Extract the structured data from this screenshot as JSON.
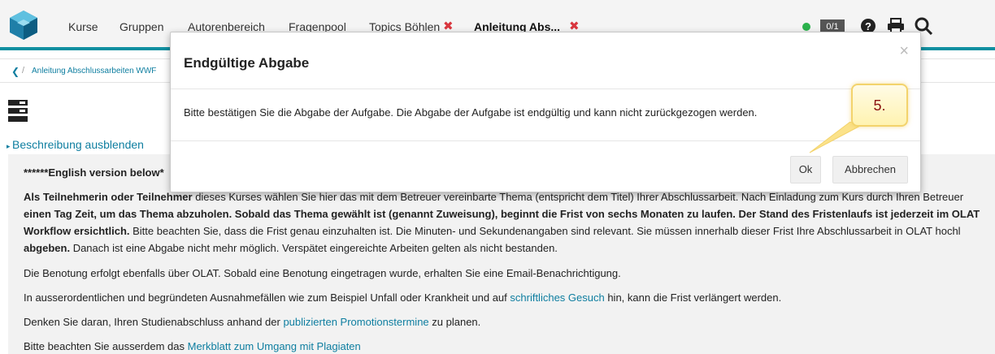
{
  "topnav": {
    "items": [
      {
        "label": "Kurse"
      },
      {
        "label": "Gruppen"
      },
      {
        "label": "Autorenbereich"
      },
      {
        "label": "Fragenpool"
      },
      {
        "label": "Topics Böhlen"
      },
      {
        "label": "Anleitung Abs..."
      }
    ],
    "badge": "0/1",
    "accent": "#0e8fa0",
    "icons": [
      "rss-icon",
      "status-online-icon",
      "help-icon",
      "print-icon",
      "search-icon"
    ]
  },
  "breadcrumb": {
    "link": "Anleitung Abschlussarbeiten WWF"
  },
  "description_toggle": "Beschreibung ausblenden",
  "content": {
    "english_note": "******English version below*",
    "p1": {
      "s1": "Als Teilnehmerin oder Teilnehmer",
      "s2": " dieses Kurses wählen Sie hier das mit dem Betreuer vereinbarte Thema (entspricht dem Titel) Ihrer Abschlussarbeit. Nach Einladung zum Kurs durch Ihren Betreuer",
      "s3": "einen Tag Zeit, um das Thema abzuholen.",
      "s4": " Sobald das Thema gewählt ist (genannt Zuweisung), beginnt die Frist von sechs Monaten zu laufen. Der Stand des Fristenlaufs ist jederzeit im OLAT",
      "s5": "Workflow ersichtlich.",
      "s6": " Bitte beachten Sie, dass die Frist genau einzuhalten ist. Die Minuten- und Sekundenangaben sind relevant. Sie müssen innerhalb dieser Frist Ihre Abschlussarbeit in OLAT hochl",
      "s7": "abgeben.",
      "s8": " Danach ist eine Abgabe nicht mehr möglich. Verspätet eingereichte Arbeiten gelten als nicht bestanden."
    },
    "p2": "Die Benotung erfolgt ebenfalls über OLAT. Sobald eine Benotung eingetragen wurde, erhalten Sie eine Email-Benachrichtigung.",
    "p3": {
      "before": " In ausserordentlichen und begründeten Ausnahmefällen wie zum Beispiel Unfall oder Krankheit und auf ",
      "link": "schriftliches Gesuch",
      "after": " hin, kann die Frist verlängert werden."
    },
    "p4": {
      "before": " Denken Sie daran, Ihren Studienabschluss anhand der ",
      "link": "publizierten Promotionstermine",
      "after": " zu planen."
    },
    "p5": {
      "before": "Bitte beachten Sie ausserdem das ",
      "link": "Merkblatt zum Umgang mit Plagiaten"
    }
  },
  "modal": {
    "title": "Endgültige Abgabe",
    "close": "×",
    "body": "Bitte bestätigen Sie die Abgabe der Aufgabe. Die Abgabe der Aufgabe ist endgültig und kann nicht zurückgezogen werden.",
    "ok_label": "Ok",
    "cancel_label": "Abbrechen"
  },
  "annotation": {
    "label": "5."
  }
}
